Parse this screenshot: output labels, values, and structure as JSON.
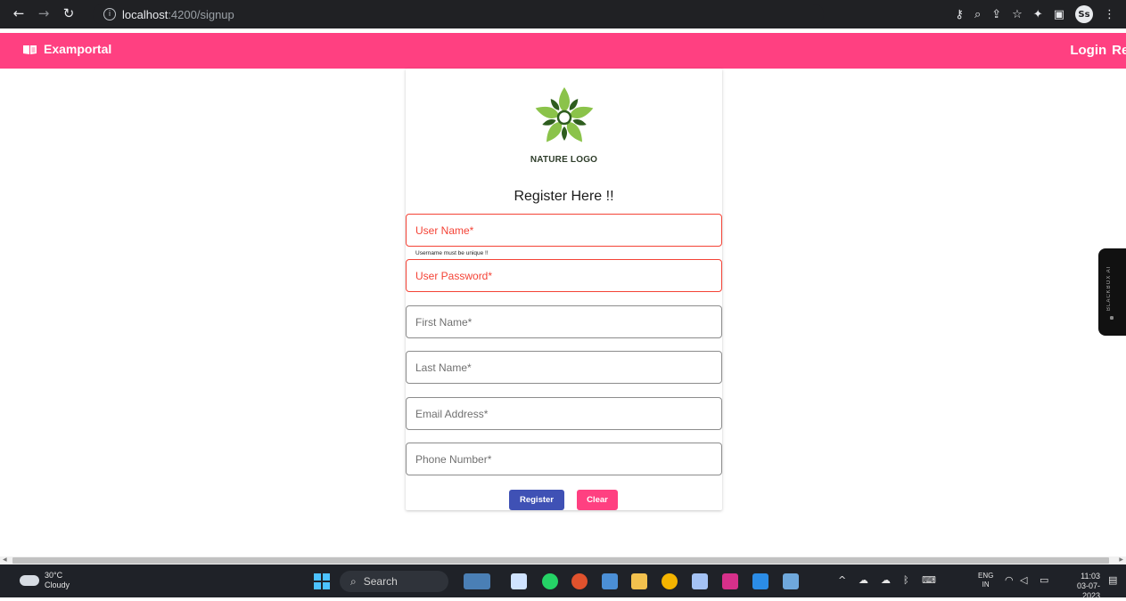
{
  "browser": {
    "url_host": "localhost",
    "url_path": ":4200/signup",
    "profile_initials": "Ss"
  },
  "toolbar": {
    "brand": "Examportal",
    "links": [
      "Login",
      "Regist"
    ]
  },
  "card": {
    "logo_text": "NATURE LOGO",
    "title": "Register Here !!",
    "fields": [
      {
        "label": "User Name*",
        "state": "error"
      },
      {
        "label": "User Password*",
        "state": "error"
      },
      {
        "label": "First Name*",
        "state": "normal"
      },
      {
        "label": "Last Name*",
        "state": "normal"
      },
      {
        "label": "Email Address*",
        "state": "normal"
      },
      {
        "label": "Phone Number*",
        "state": "normal"
      }
    ],
    "username_hint": "Username must be unique !!",
    "register_label": "Register",
    "clear_label": "Clear"
  },
  "side_widget": {
    "text": "BLACKBOX AI"
  },
  "taskbar": {
    "temperature": "30°C",
    "weather": "Cloudy",
    "search_label": "Search",
    "lang_top": "ENG",
    "lang_bottom": "IN",
    "time": "11:03",
    "date": "03-07-2023"
  },
  "colors": {
    "toolbar": "#ff4081",
    "primary_button": "#3f51b5",
    "accent_button": "#ff4081",
    "error": "#f44336"
  }
}
